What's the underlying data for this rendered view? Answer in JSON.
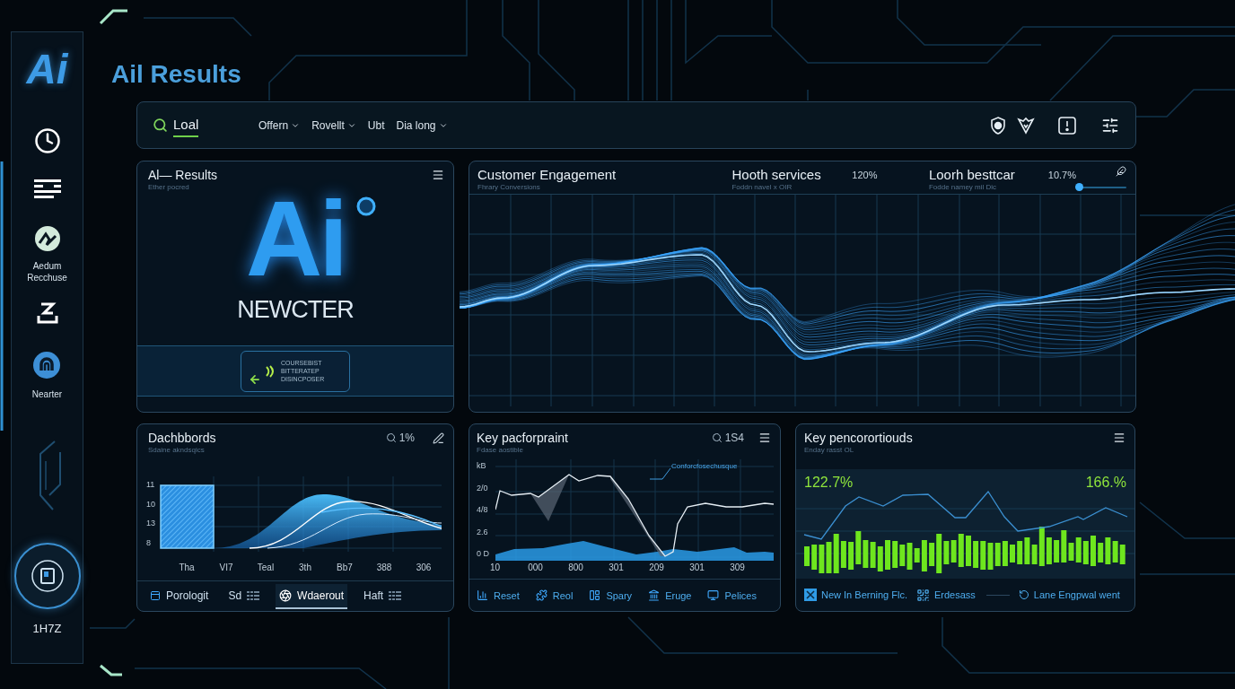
{
  "sidebar": {
    "logo": "Ai",
    "items": [
      {
        "label": "Aedum Recchuse"
      },
      {
        "label": "Nearter"
      }
    ],
    "badge": "1H7Z"
  },
  "title": "Ail Results",
  "toolbar": {
    "search": {
      "value": "Loal"
    },
    "menus": [
      {
        "label": "Offern",
        "dropdown": true
      },
      {
        "label": "Rovellt",
        "dropdown": true
      },
      {
        "label": "Ubt",
        "dropdown": false
      },
      {
        "label": "Dia long",
        "dropdown": true
      }
    ]
  },
  "results_panel": {
    "title": "Al— Results",
    "subtitle": "Ether pocred",
    "logo": "Ai",
    "wordmark": "NEWCTER",
    "card_lines": [
      "COURSEBIST",
      "BITTERATEP",
      "DISINCPOSER"
    ]
  },
  "engagement_panel": {
    "title": "Customer Engagement",
    "subtitle": "Fhrary Conversions",
    "metrics": [
      {
        "label": "Hooth services",
        "subtitle": "Foddn navel x OIR",
        "value": "120%"
      },
      {
        "label": "Loorh besttcar",
        "subtitle": "Fodde namey mil Dic",
        "value": "10.7%"
      }
    ],
    "slider": {
      "level": 0.05
    }
  },
  "dashboards_panel": {
    "title": "Dachbbords",
    "subtitle": "Sdaine akndsqics",
    "reading": "1%",
    "y_labels": [
      "11",
      "10",
      "13",
      "8"
    ],
    "x_labels": [
      "Tha",
      "VI7",
      "Teal",
      "3th",
      "Bb7",
      "388",
      "306"
    ],
    "tabs": [
      {
        "label": "Porologit",
        "selected": false
      },
      {
        "label": "Sd",
        "selected": false
      },
      {
        "label": "Wdaerout",
        "selected": true
      },
      {
        "label": "Haft",
        "selected": false
      }
    ]
  },
  "performance_panel": {
    "title": "Key pacforpraint",
    "subtitle": "Fdase aostible",
    "reading": "1S4",
    "annotation": "Conforcfosechusque",
    "y_labels": [
      "kB",
      "2/0",
      "4/8",
      "2.6",
      "0 D"
    ],
    "x_labels": [
      "10",
      "000",
      "800",
      "301",
      "209",
      "301",
      "309"
    ],
    "actions": [
      "Reset",
      "Reol",
      "Spary",
      "Eruge",
      "Pelices"
    ]
  },
  "proportions_panel": {
    "title": "Key pencorortiouds",
    "subtitle": "Enday rasst OL",
    "readings": [
      "122.7%",
      "166.%"
    ],
    "links": [
      "New In Berning Flc.",
      "Erdesass",
      "Lane Engpwal went"
    ]
  }
}
